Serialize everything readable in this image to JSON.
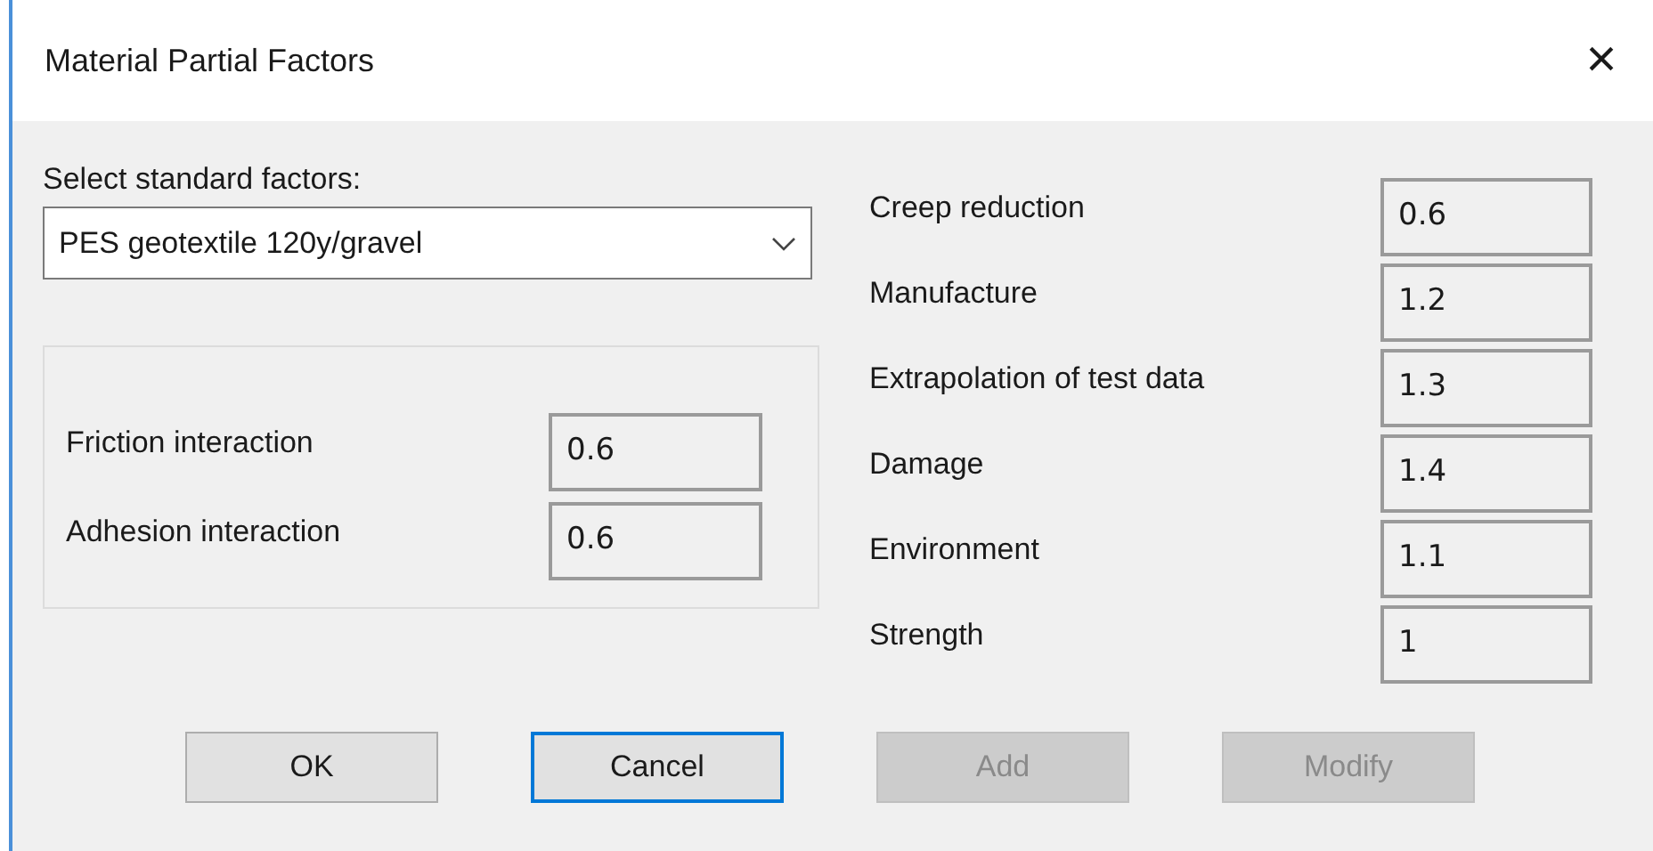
{
  "window": {
    "title": "Material Partial Factors",
    "close": "×"
  },
  "standard": {
    "label": "Select standard factors:",
    "value": "PES geotextile 120y/gravel"
  },
  "interaction": [
    {
      "label": "Friction interaction",
      "value": "0.6"
    },
    {
      "label": "Adhesion interaction",
      "value": "0.6"
    }
  ],
  "factors": [
    {
      "label": "Creep reduction",
      "value": "0.6"
    },
    {
      "label": "Manufacture",
      "value": "1.2"
    },
    {
      "label": "Extrapolation of test data",
      "value": "1.3"
    },
    {
      "label": "Damage",
      "value": "1.4"
    },
    {
      "label": "Environment",
      "value": "1.1"
    },
    {
      "label": "Strength",
      "value": "1"
    }
  ],
  "buttons": [
    {
      "label": "OK",
      "focused": false,
      "disabled": false
    },
    {
      "label": "Cancel",
      "focused": true,
      "disabled": false
    },
    {
      "label": "Add",
      "focused": false,
      "disabled": true
    },
    {
      "label": "Modify",
      "focused": false,
      "disabled": true
    }
  ]
}
